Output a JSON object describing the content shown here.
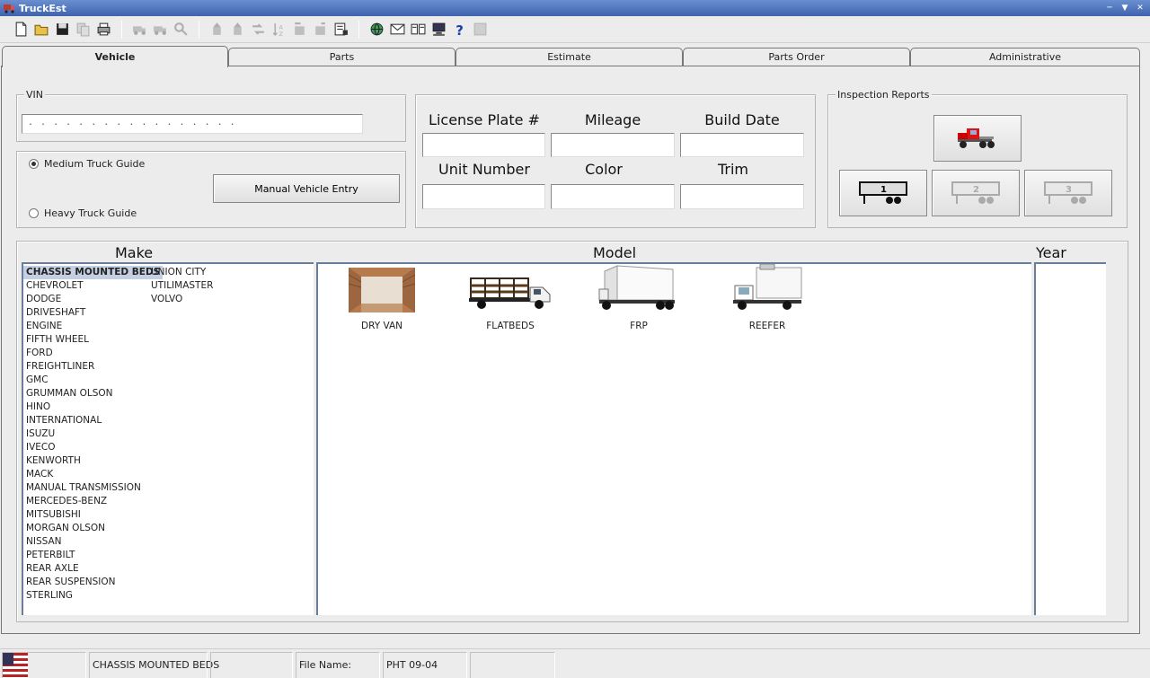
{
  "window": {
    "title": "TruckEst"
  },
  "toolbar": {
    "icons": [
      "new-icon",
      "open-icon",
      "save-icon",
      "copy-icon",
      "print-icon",
      "truck-icon",
      "truck-icon",
      "search-icon",
      "up-icon",
      "up-icon",
      "shuffle-icon",
      "sort-icon",
      "move-icon",
      "move-icon",
      "report-icon",
      "globe-icon",
      "mail-icon",
      "book-icon",
      "computer-icon",
      "help-icon",
      "stop-icon"
    ]
  },
  "tabs": [
    "Vehicle",
    "Parts",
    "Estimate",
    "Parts Order",
    "Administrative"
  ],
  "vin": {
    "label": "VIN",
    "placeholder": ". . . . . . . . . . . . . . . . ."
  },
  "guide": {
    "medium": "Medium Truck Guide",
    "heavy": "Heavy Truck Guide",
    "manual_button": "Manual Vehicle Entry"
  },
  "details": {
    "license": "License Plate #",
    "mileage": "Mileage",
    "build_date": "Build Date",
    "unit_number": "Unit Number",
    "color": "Color",
    "trim": "Trim"
  },
  "inspection": {
    "label": "Inspection Reports",
    "buttons": [
      "1",
      "2",
      "3"
    ]
  },
  "headers": {
    "make": "Make",
    "model": "Model",
    "year": "Year"
  },
  "makes_col1": [
    "CHASSIS MOUNTED BEDS",
    "CHEVROLET",
    "DODGE",
    "DRIVESHAFT",
    "ENGINE",
    "FIFTH WHEEL",
    "FORD",
    "FREIGHTLINER",
    "GMC",
    "GRUMMAN OLSON",
    "HINO",
    "INTERNATIONAL",
    "ISUZU",
    "IVECO",
    "KENWORTH",
    "MACK",
    "MANUAL TRANSMISSION",
    "MERCEDES-BENZ",
    "MITSUBISHI",
    "MORGAN OLSON",
    "NISSAN",
    "PETERBILT",
    "REAR AXLE",
    "REAR SUSPENSION",
    "STERLING"
  ],
  "makes_col2": [
    "UNION CITY",
    "UTILIMASTER",
    "VOLVO"
  ],
  "selected_make": "CHASSIS MOUNTED BEDS",
  "models": [
    "DRY VAN",
    "FLATBEDS",
    "FRP",
    "REEFER"
  ],
  "status": {
    "make": "CHASSIS MOUNTED BEDS",
    "file_label": "File Name:",
    "file_name": "PHT 09-04"
  }
}
